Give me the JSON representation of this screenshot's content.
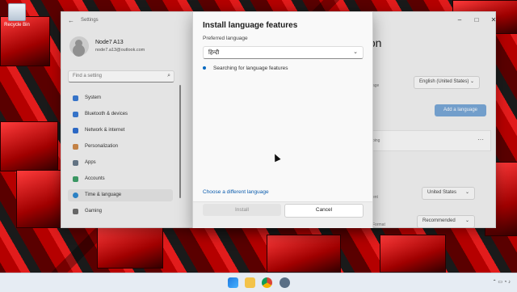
{
  "desktop": {
    "recycle_bin_label": "Recycle Bin"
  },
  "settings": {
    "app_title": "Settings",
    "user": {
      "name": "Node7 A13",
      "email": "node7.a13@outlook.com"
    },
    "search_placeholder": "Find a setting",
    "nav": [
      {
        "label": "System",
        "icon": "monitor-icon",
        "color": "#3a7bd5"
      },
      {
        "label": "Bluetooth & devices",
        "icon": "bluetooth-icon",
        "color": "#3a7bd5"
      },
      {
        "label": "Network & internet",
        "icon": "wifi-icon",
        "color": "#2f6fd1"
      },
      {
        "label": "Personalization",
        "icon": "brush-icon",
        "color": "#d08a4a"
      },
      {
        "label": "Apps",
        "icon": "apps-icon",
        "color": "#6a7b8c"
      },
      {
        "label": "Accounts",
        "icon": "person-icon",
        "color": "#3fa06a"
      },
      {
        "label": "Time & language",
        "icon": "globe-icon",
        "color": "#2f8ad1"
      },
      {
        "label": "Gaming",
        "icon": "gamepad-icon",
        "color": "#6d6d6d"
      }
    ],
    "active_nav": "Time & language",
    "right_heading": "gion",
    "display_language_value": "English (United States)",
    "add_language_label": "Add a language",
    "region_country_value": "United States",
    "regional_format_value": "Recommended",
    "partial_labels": {
      "row1": "age",
      "row2": "ping",
      "row3": "ent",
      "row4": "Format"
    }
  },
  "dialog": {
    "title": "Install language features",
    "preferred_language_label": "Preferred language",
    "selected_language": "हिन्दी",
    "status_text": "Searching for language features",
    "choose_link": "Choose a different language",
    "install_label": "Install",
    "cancel_label": "Cancel"
  },
  "taskbar": {
    "icons": [
      "start-icon",
      "search-icon",
      "file-explorer-icon",
      "chrome-icon",
      "settings-icon"
    ]
  },
  "colors": {
    "accent": "#0067c0",
    "link": "#0b5cad"
  }
}
